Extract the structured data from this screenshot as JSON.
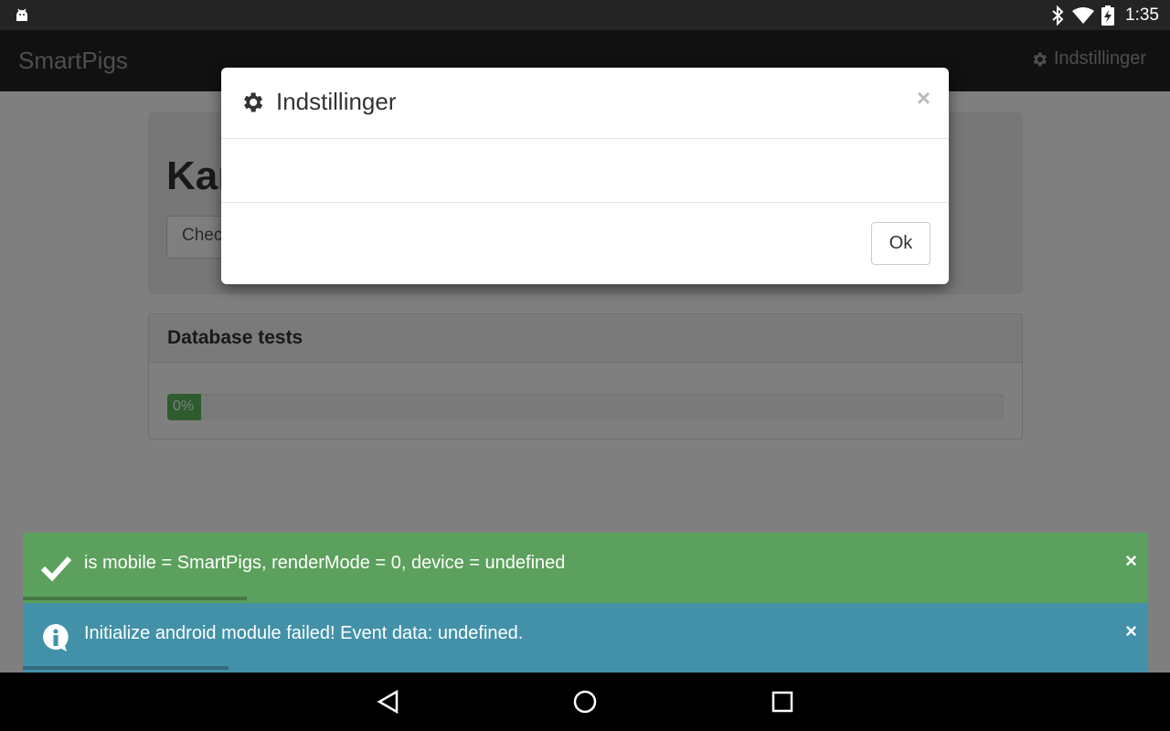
{
  "status_bar": {
    "notification_icon": "android-icon",
    "icons": [
      "bluetooth-icon",
      "wifi-icon",
      "battery-charging-icon"
    ],
    "time": "1:35"
  },
  "navbar": {
    "brand": "SmartPigs",
    "settings_label": "Indstillinger",
    "settings_icon": "gear-icon"
  },
  "page": {
    "jumbotron_title": "Kar",
    "jumbotron_input_value": "Chec",
    "panel_title": "Database tests",
    "progress_label": "0%",
    "progress_fraction": 0.0
  },
  "modal": {
    "title": "Indstillinger",
    "title_icon": "gear-icon",
    "close": "×",
    "ok_label": "Ok"
  },
  "notifications": [
    {
      "type": "success",
      "icon": "checkmark-icon",
      "message": "is mobile = SmartPigs, renderMode = 0, device = undefined",
      "close": "×",
      "color": "#5ba05c"
    },
    {
      "type": "info",
      "icon": "info-icon",
      "message": "Initialize android module failed! Event data: undefined.",
      "close": "×",
      "color": "#4291a9"
    }
  ],
  "system_nav": [
    "back-icon",
    "home-icon",
    "recents-icon"
  ]
}
